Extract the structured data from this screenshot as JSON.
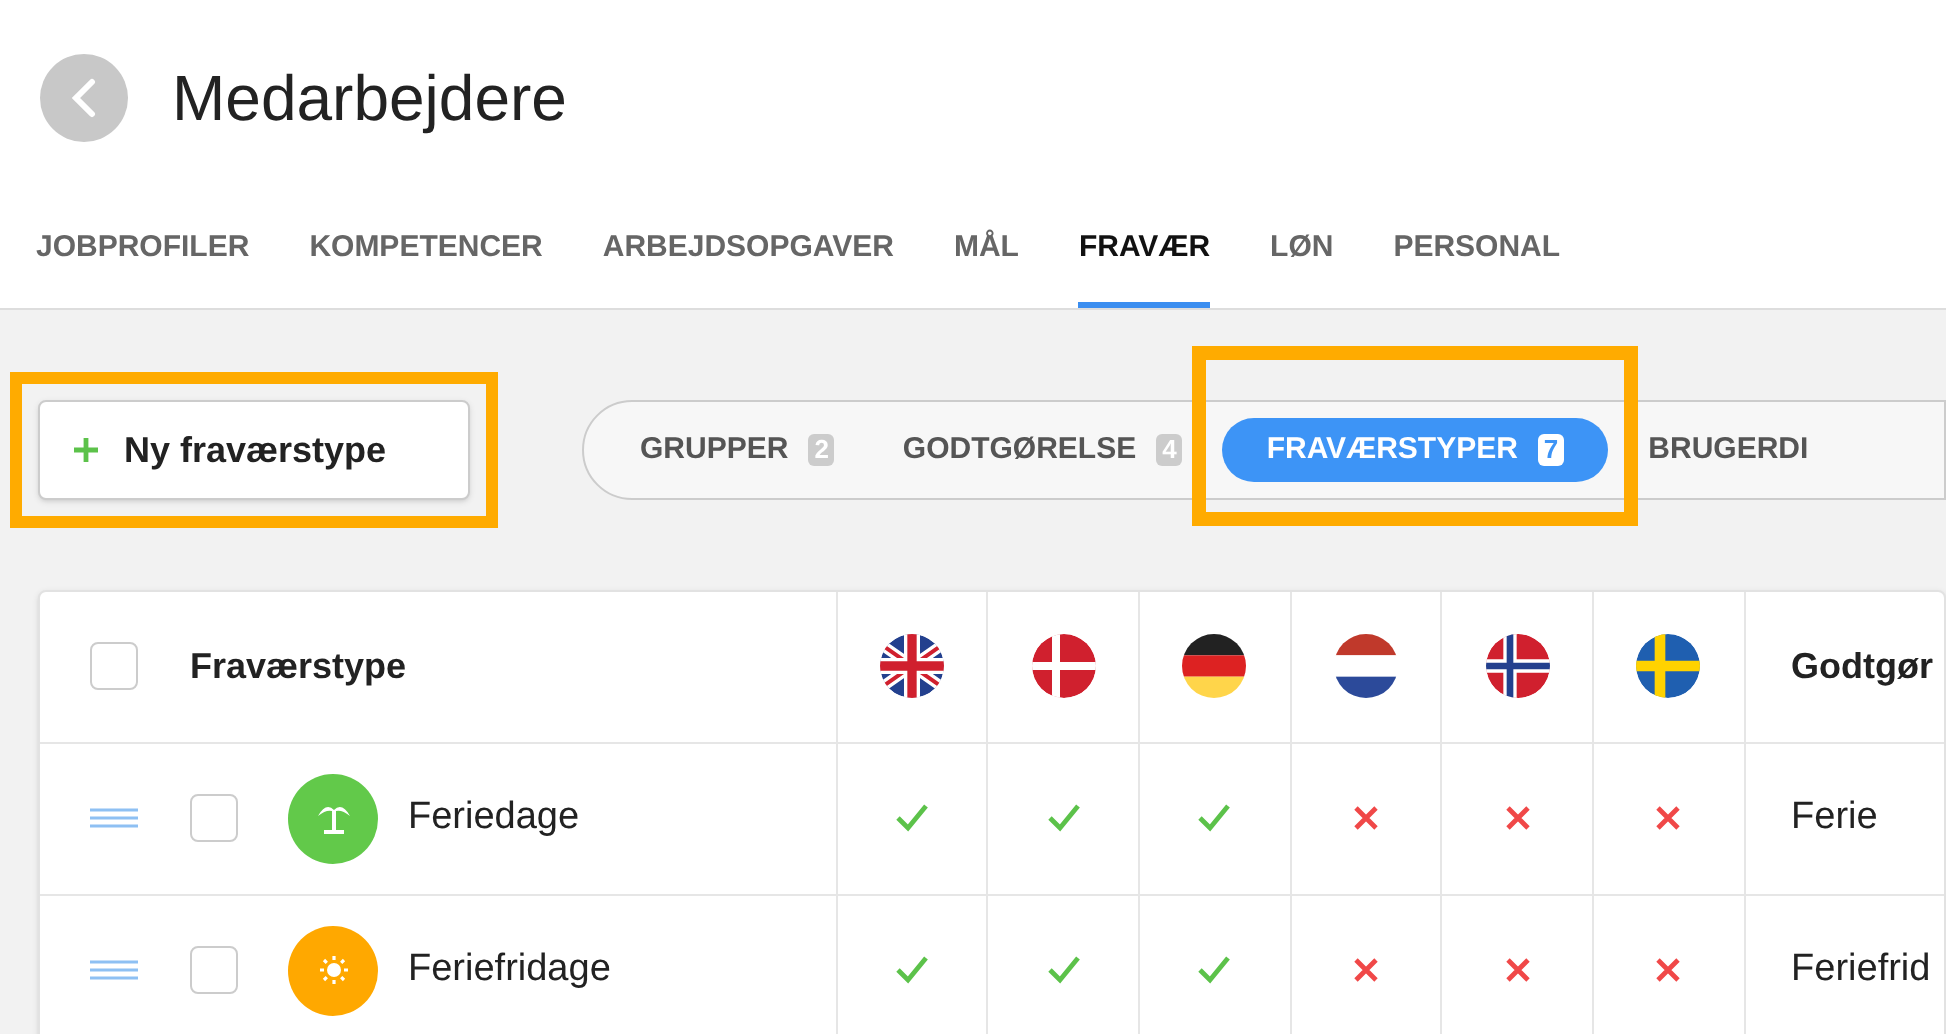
{
  "header": {
    "title": "Medarbejdere"
  },
  "tabs": [
    {
      "label": "JOBPROFILER",
      "selected": false
    },
    {
      "label": "KOMPETENCER",
      "selected": false
    },
    {
      "label": "ARBEJDSOPGAVER",
      "selected": false
    },
    {
      "label": "MÅL",
      "selected": false
    },
    {
      "label": "FRAVÆR",
      "selected": true
    },
    {
      "label": "LØN",
      "selected": false
    },
    {
      "label": "PERSONAL",
      "selected": false
    }
  ],
  "new_button": {
    "label": "Ny fraværstype",
    "highlighted": true
  },
  "segments": [
    {
      "label": "GRUPPER",
      "count": "2",
      "selected": false,
      "highlighted": false
    },
    {
      "label": "GODTGØRELSE",
      "count": "4",
      "selected": false,
      "highlighted": false
    },
    {
      "label": "FRAVÆRSTYPER",
      "count": "7",
      "selected": true,
      "highlighted": true
    },
    {
      "label": "BRUGERDI",
      "selected": false,
      "highlighted": false
    }
  ],
  "table": {
    "select_all_checked": false,
    "name_column": "Fraværstype",
    "last_column": "Godtgør",
    "rows": [
      {
        "name": "Feriedage",
        "color": "#62c94a",
        "checked": false,
        "available": [
          true,
          true,
          true,
          false,
          false,
          false
        ],
        "compensation": "Ferie"
      },
      {
        "name": "Feriefridage",
        "color": "#ffa800",
        "checked": false,
        "available": [
          true,
          true,
          true,
          false,
          false,
          false
        ],
        "compensation": "Feriefrid"
      }
    ]
  }
}
